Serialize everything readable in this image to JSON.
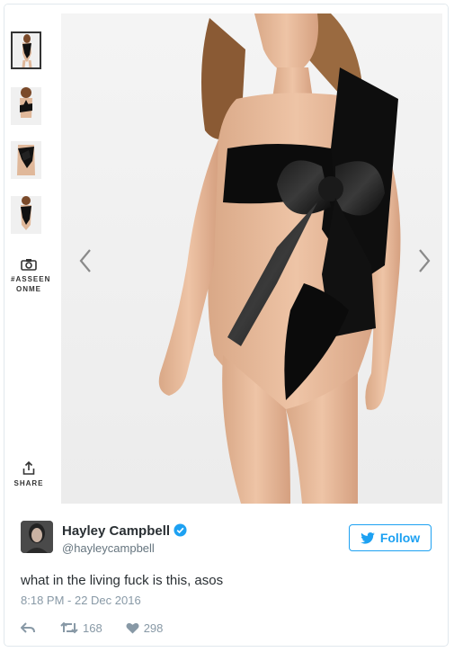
{
  "side_actions": {
    "as_seen_on_me_label": "#ASSEEN ONME",
    "share_label": "SHARE"
  },
  "author": {
    "display_name": "Hayley Campbell",
    "handle": "@hayleycampbell",
    "verified": true
  },
  "follow_button": {
    "label": "Follow"
  },
  "tweet": {
    "text": "what in the living fuck is this, asos",
    "timestamp": "8:18 PM - 22 Dec 2016"
  },
  "stats": {
    "retweets": "168",
    "likes": "298"
  },
  "colors": {
    "twitter_blue": "#1da1f2",
    "text_primary": "#292f33",
    "text_secondary": "#8899a6"
  },
  "icons": [
    "camera-icon",
    "share-icon",
    "chevron-left-icon",
    "chevron-right-icon",
    "verified-icon",
    "twitter-bird-icon",
    "reply-icon",
    "retweet-icon",
    "heart-icon"
  ]
}
